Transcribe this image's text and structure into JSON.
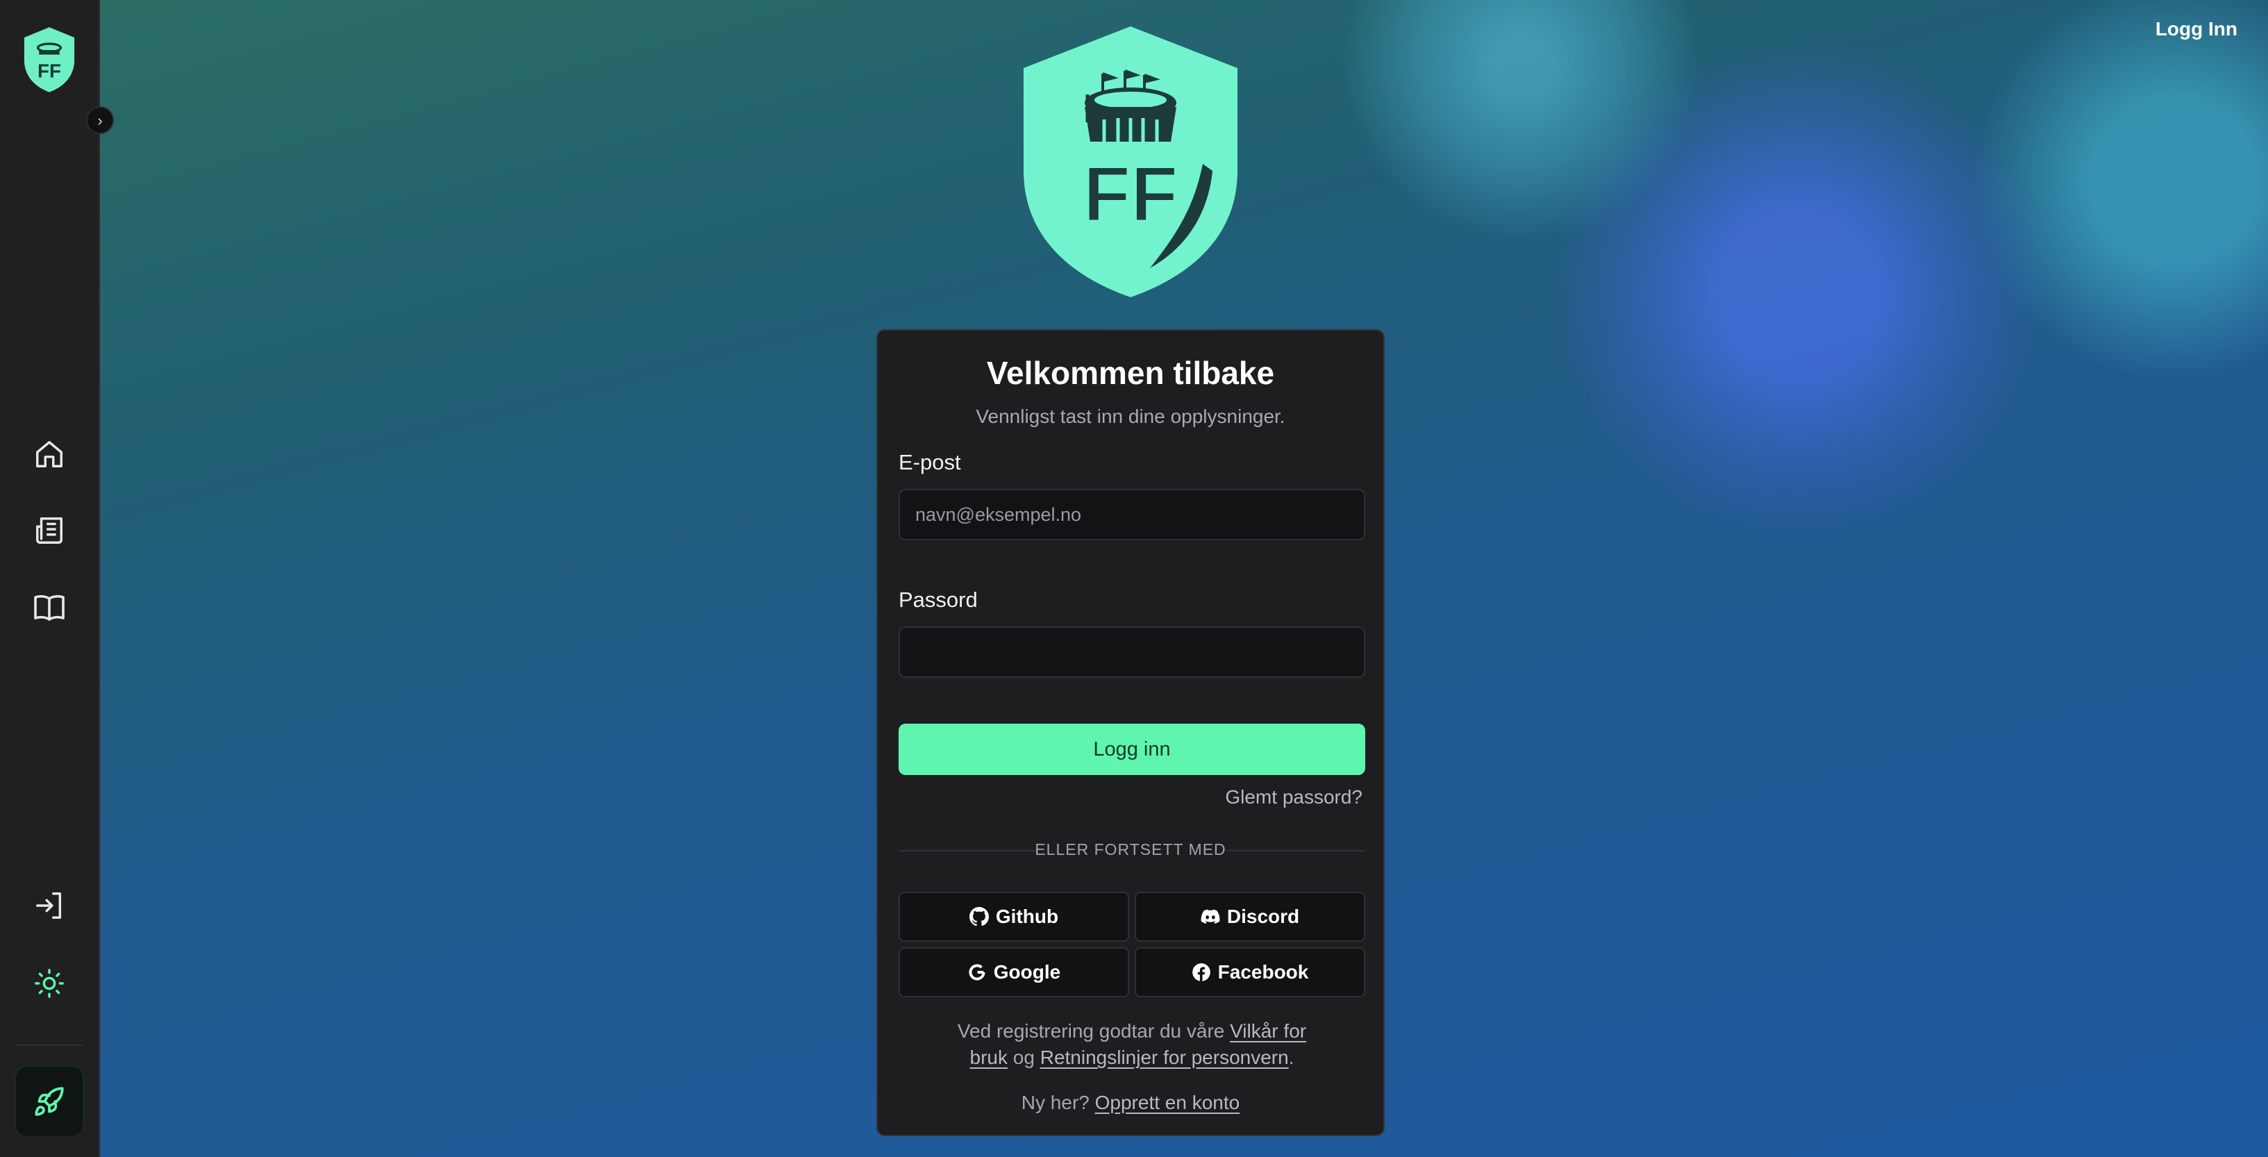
{
  "header": {
    "login_link": "Logg Inn"
  },
  "sidebar": {
    "logo_letters": "FF",
    "items": [
      {
        "icon": "home-icon"
      },
      {
        "icon": "newspaper-icon"
      },
      {
        "icon": "book-icon"
      },
      {
        "icon": "login-icon"
      },
      {
        "icon": "sun-icon"
      },
      {
        "icon": "rocket-icon"
      }
    ]
  },
  "hero": {
    "logo_letters": "FF"
  },
  "card": {
    "title": "Velkommen tilbake",
    "subtitle": "Vennligst tast inn dine opplysninger.",
    "email_label": "E-post",
    "email_placeholder": "navn@eksempel.no",
    "password_label": "Passord",
    "password_value": "",
    "login_button": "Logg inn",
    "forgot_password": "Glemt passord?",
    "separator": "ELLER FORTSETT MED",
    "social": {
      "github": "Github",
      "discord": "Discord",
      "google": "Google",
      "facebook": "Facebook"
    },
    "terms_prefix": "Ved registrering godtar du våre",
    "terms_link": "Vilkår for bruk",
    "terms_and": "og",
    "privacy_link": "Retningslinjer for personvern",
    "terms_suffix": ".",
    "signup_prefix": "Ny her?",
    "signup_link": "Opprett en konto"
  },
  "colors": {
    "accent": "#5ff5ae",
    "card_bg": "#1e1e21",
    "sidebar_bg": "#202022"
  }
}
